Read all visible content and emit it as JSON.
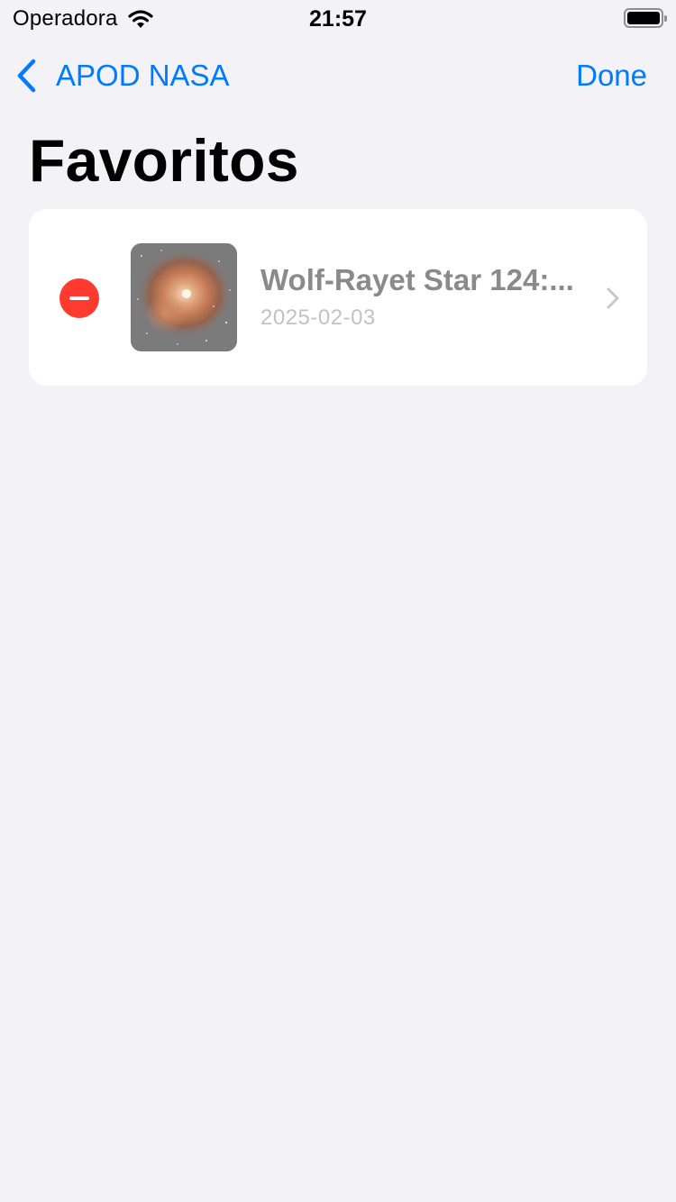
{
  "status_bar": {
    "carrier": "Operadora",
    "time": "21:57",
    "icons": [
      "wifi-icon",
      "battery-icon"
    ]
  },
  "nav": {
    "back_label": "APOD NASA",
    "done_label": "Done"
  },
  "title": "Favoritos",
  "favorites": [
    {
      "title": "Wolf-Rayet Star 124:...",
      "date": "2025-02-03",
      "thumbnail": "nebula-thumbnail"
    }
  ],
  "colors": {
    "accent": "#007aff",
    "delete": "#ff3b30",
    "background": "#f2f2f7"
  }
}
